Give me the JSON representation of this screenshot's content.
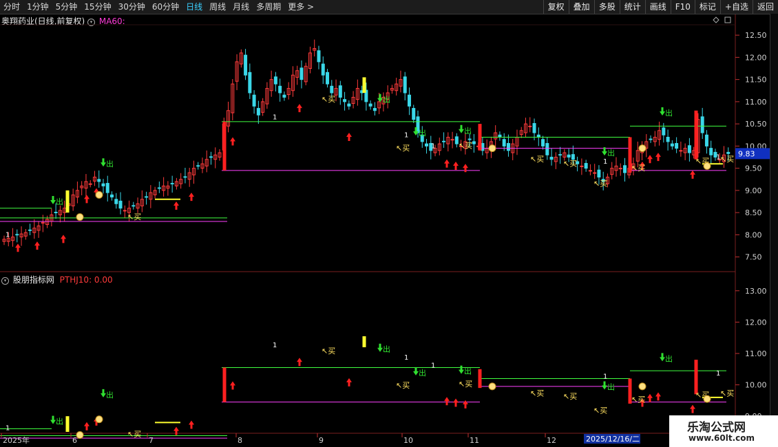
{
  "toolbar": {
    "left": [
      "分时",
      "1分钟",
      "5分钟",
      "15分钟",
      "30分钟",
      "60分钟",
      "日线",
      "周线",
      "月线",
      "多周期",
      "更多 >"
    ],
    "active": "日线",
    "right": [
      "复权",
      "叠加",
      "多股",
      "统计",
      "画线",
      "F10",
      "标记",
      "+自选",
      "返回"
    ]
  },
  "main_panel": {
    "title": "奥翔药业(日线,前复权)",
    "indicator": "MA60:",
    "indicator_color": "#ff3bd8",
    "current_price": "9.83",
    "price_ticks": [
      "12.50",
      "12.00",
      "11.50",
      "11.00",
      "10.50",
      "10.00",
      "9.50",
      "9.00",
      "8.50",
      "8.00",
      "7.50"
    ]
  },
  "sub_panel": {
    "title": "股朋指标网",
    "indicator": "PTHJ10: 0.00",
    "indicator_color": "#ff3b3b",
    "ticks": [
      "13.00",
      "12.00",
      "11.00",
      "10.00",
      "9.00"
    ]
  },
  "timeline": {
    "labels": [
      "2025年",
      "6",
      "7",
      "8",
      "9",
      "10",
      "11",
      "12"
    ],
    "cursor_date": "2025/12/16/二"
  },
  "chart_data": {
    "type": "candlestick",
    "title": "奥翔药业(日线,前复权)",
    "ylim": [
      7.2,
      12.75
    ],
    "up_color": "#ff3b3b",
    "down_color": "#3ad7e8",
    "signal_buy": "买",
    "signal_sell": "出",
    "signal_count": "1",
    "close": [
      7.9,
      7.92,
      7.95,
      8.0,
      8.02,
      8.05,
      8.1,
      8.15,
      8.2,
      8.28,
      8.35,
      8.45,
      8.5,
      8.55,
      8.6,
      8.7,
      8.9,
      9.0,
      9.1,
      9.2,
      9.15,
      9.3,
      9.2,
      9.1,
      8.95,
      8.85,
      8.7,
      8.6,
      8.55,
      8.6,
      8.65,
      8.7,
      8.8,
      8.85,
      8.95,
      9.0,
      9.05,
      9.1,
      9.1,
      9.15,
      9.2,
      9.25,
      9.3,
      9.4,
      9.5,
      9.55,
      9.6,
      9.7,
      9.75,
      9.8,
      9.85,
      10.5,
      10.8,
      11.4,
      11.9,
      12.1,
      11.6,
      11.2,
      10.9,
      10.7,
      11.0,
      11.3,
      11.5,
      11.4,
      11.2,
      11.1,
      11.3,
      11.6,
      11.7,
      11.5,
      11.8,
      12.1,
      12.2,
      11.9,
      11.6,
      11.4,
      11.2,
      11.3,
      11.1,
      11.0,
      10.9,
      11.1,
      11.3,
      11.2,
      11.0,
      10.9,
      10.8,
      11.0,
      11.1,
      11.2,
      11.3,
      11.4,
      11.5,
      11.2,
      10.9,
      10.6,
      10.3,
      10.1,
      10.0,
      9.9,
      9.95,
      10.05,
      10.1,
      10.2,
      10.15,
      10.05,
      10.0,
      10.1,
      10.15,
      10.05,
      10.0,
      9.9,
      9.95,
      10.1,
      10.3,
      10.2,
      10.0,
      9.9,
      10.05,
      10.2,
      10.35,
      10.5,
      10.45,
      10.3,
      10.2,
      10.0,
      9.8,
      9.7,
      9.75,
      9.8,
      9.85,
      9.75,
      9.7,
      9.6,
      9.55,
      9.5,
      9.45,
      9.4,
      9.3,
      9.2,
      9.3,
      9.5,
      9.55,
      9.5,
      9.4,
      9.5,
      9.6,
      9.9,
      10.0,
      10.1,
      10.15,
      10.2,
      10.35,
      10.25,
      10.1,
      10.0,
      9.95,
      9.9,
      9.95,
      9.85,
      9.9,
      10.6,
      10.3,
      10.0,
      9.8,
      9.75,
      9.7,
      9.8,
      9.83
    ]
  }
}
